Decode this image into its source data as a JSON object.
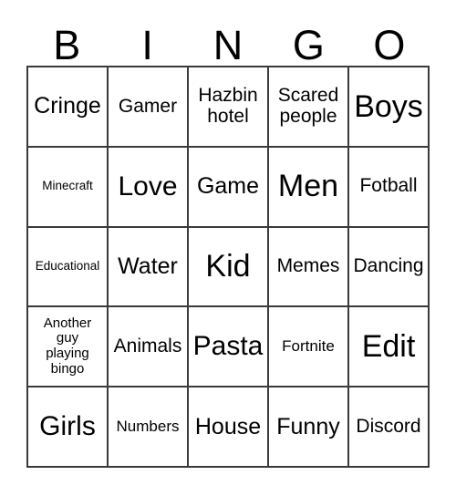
{
  "card": {
    "title": "BINGO",
    "header_letters": [
      "B",
      "I",
      "N",
      "G",
      "O"
    ],
    "rows": [
      [
        {
          "text": "Cringe",
          "size": "fs-md"
        },
        {
          "text": "Gamer",
          "size": "fs-sm"
        },
        {
          "text": "Hazbin\nhotel",
          "size": "fs-sm"
        },
        {
          "text": "Scared\npeople",
          "size": "fs-sm"
        },
        {
          "text": "Boys",
          "size": "fs-xl"
        }
      ],
      [
        {
          "text": "Minecraft",
          "size": "fs-xxs"
        },
        {
          "text": "Love",
          "size": "fs-lg"
        },
        {
          "text": "Game",
          "size": "fs-md"
        },
        {
          "text": "Men",
          "size": "fs-xl"
        },
        {
          "text": "Fotball",
          "size": "fs-sm"
        }
      ],
      [
        {
          "text": "Educational",
          "size": "fs-xxs"
        },
        {
          "text": "Water",
          "size": "fs-md"
        },
        {
          "text": "Kid",
          "size": "fs-xl"
        },
        {
          "text": "Memes",
          "size": "fs-sm"
        },
        {
          "text": "Dancing",
          "size": "fs-sm"
        }
      ],
      [
        {
          "text": "Another\nguy\nplaying\nbingo",
          "size": "fs-tiny"
        },
        {
          "text": "Animals",
          "size": "fs-sm"
        },
        {
          "text": "Pasta",
          "size": "fs-lg"
        },
        {
          "text": "Fortnite",
          "size": "fs-xs"
        },
        {
          "text": "Edit",
          "size": "fs-xl"
        }
      ],
      [
        {
          "text": "Girls",
          "size": "fs-lg"
        },
        {
          "text": "Numbers",
          "size": "fs-xs"
        },
        {
          "text": "House",
          "size": "fs-md"
        },
        {
          "text": "Funny",
          "size": "fs-md"
        },
        {
          "text": "Discord",
          "size": "fs-sm"
        }
      ]
    ]
  },
  "colors": {
    "background": "#ffffff",
    "text": "#000000",
    "grid_line": "#3a3a3a"
  }
}
